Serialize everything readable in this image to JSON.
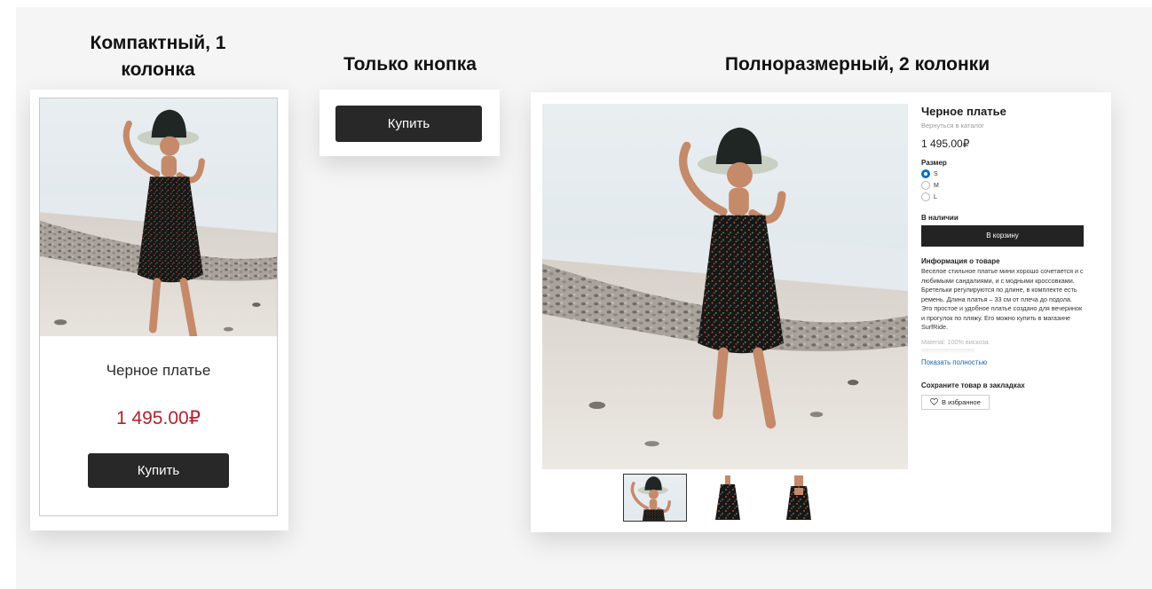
{
  "sections": {
    "compact_title": "Компактный, 1 колонка",
    "button_only_title": "Только кнопка",
    "full_title": "Полноразмерный, 2 колонки"
  },
  "product": {
    "name": "Черное платье",
    "price": "1 495.00₽",
    "back_link": "Вернуться в каталог",
    "buy_label": "Купить",
    "size_label": "Размер",
    "sizes": [
      "S",
      "M",
      "L"
    ],
    "selected_size": "S",
    "availability": "В наличии",
    "cart_label": "В корзину",
    "info_title": "Информация о товаре",
    "description": "Веселое стильное платье мини хорошо сочетается и с любимыми сандалиями, и с модными кроссовками. Бретельки регулируются по длине, в комплекте есть ремень. Длина платья – 33 см от плеча до подола. Это простое и удобное платье создано для вечеринок и прогулок по пляжу. Его можно купить в магазине SurfRide.",
    "material": "Material: 100% вискоза",
    "show_more": "Показать полностью",
    "bookmark_title": "Сохраните товар в закладках",
    "favorite_label": "В избранное"
  },
  "colors": {
    "price_red": "#b51f2e",
    "button_dark": "#282828",
    "radio_selected": "#0a6fc2",
    "link_blue": "#1d63b3"
  },
  "icons": {
    "favorite": "heart-outline-icon"
  }
}
